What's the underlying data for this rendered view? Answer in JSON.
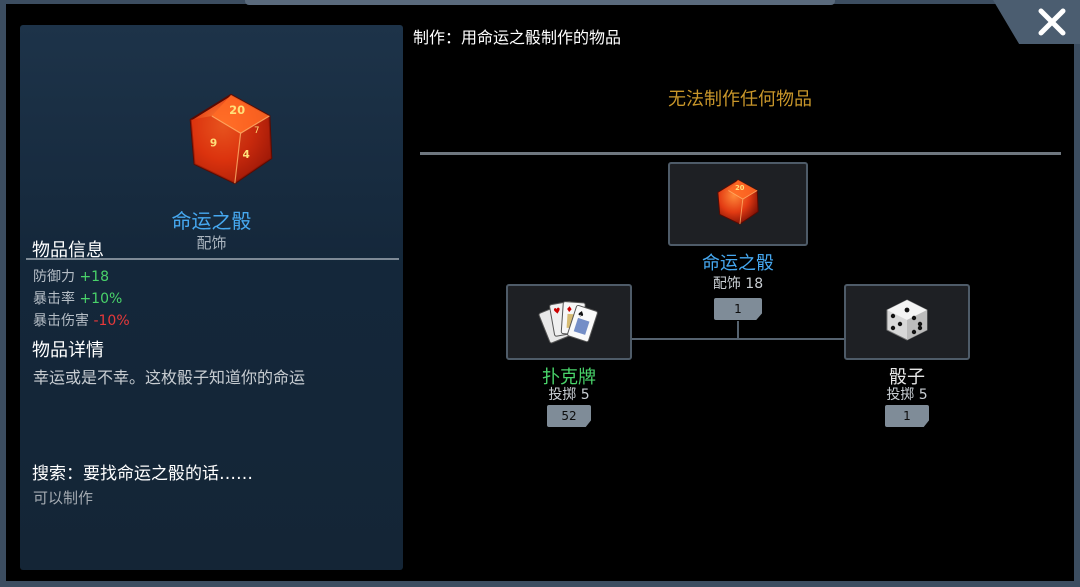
{
  "left": {
    "item_name": "命运之骰",
    "item_type": "配饰",
    "info_title": "物品信息",
    "stats": [
      {
        "label": "防御力",
        "value": "+18"
      },
      {
        "label": "暴击率",
        "value": "+10%"
      },
      {
        "label": "暴击伤害",
        "value": "-10%"
      }
    ],
    "details_title": "物品详情",
    "description": "幸运或是不幸。这枚骰子知道你的命运",
    "search_title": "搜索：要找命运之骰的话……",
    "search_result": "可以制作"
  },
  "right": {
    "header": "制作：用命运之骰制作的物品",
    "empty_message": "无法制作任何物品",
    "tree": {
      "result": {
        "name": "命运之骰",
        "sub": "配饰 18",
        "count": "1"
      },
      "ingredients": [
        {
          "name": "扑克牌",
          "sub": "投掷 5",
          "count": "52"
        },
        {
          "name": "骰子",
          "sub": "投掷 5",
          "count": "1"
        }
      ]
    }
  },
  "colors": {
    "title_blue": "#46a8f0",
    "positive": "#49d36a",
    "negative": "#e8393a",
    "warning_gold": "#c8962a",
    "ingredient_green": "#49d36a"
  },
  "icons": {
    "item": "d20-fate-dice-icon",
    "cards": "playing-cards-icon",
    "dice": "white-dice-icon",
    "close": "close-icon"
  }
}
